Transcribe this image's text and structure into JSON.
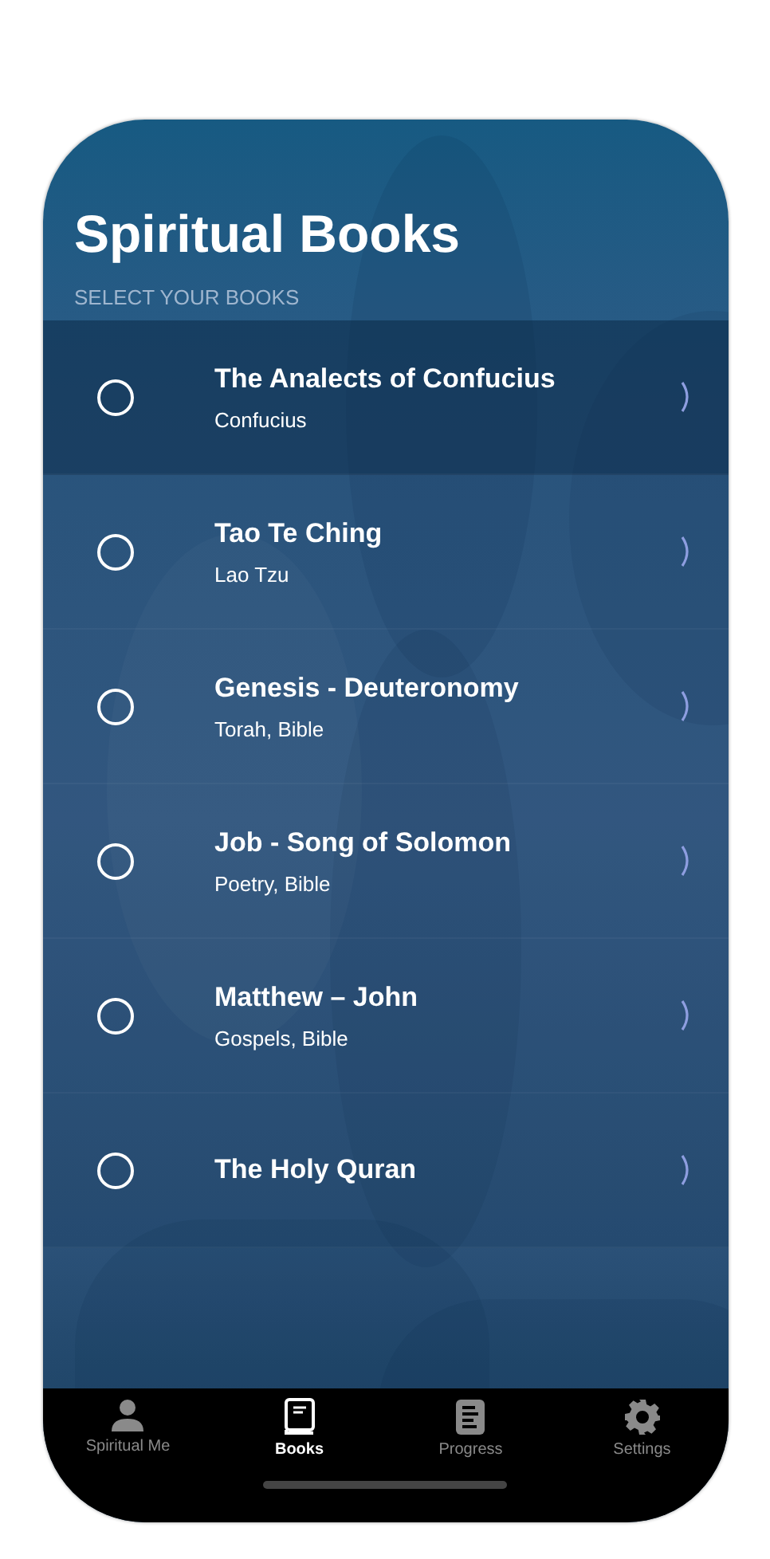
{
  "header": {
    "title": "Spiritual Books",
    "section_label": "SELECT YOUR BOOKS"
  },
  "books": [
    {
      "title": "The Analects of Confucius",
      "subtitle": "Confucius",
      "checked": false,
      "highlighted": true
    },
    {
      "title": "Tao Te Ching",
      "subtitle": "Lao Tzu",
      "checked": false,
      "highlighted": false
    },
    {
      "title": "Genesis - Deuteronomy",
      "subtitle": "Torah, Bible",
      "checked": false,
      "highlighted": false
    },
    {
      "title": "Job - Song of Solomon",
      "subtitle": "Poetry, Bible",
      "checked": false,
      "highlighted": false
    },
    {
      "title": "Matthew – John",
      "subtitle": "Gospels, Bible",
      "checked": false,
      "highlighted": false
    },
    {
      "title": "The Holy Quran",
      "checked": false,
      "highlighted": false
    }
  ],
  "tab_bar": [
    {
      "label": "Spiritual Me",
      "kind": "person",
      "selected": false
    },
    {
      "label": "Books",
      "kind": "book",
      "selected": true
    },
    {
      "label": "Progress",
      "kind": "progress",
      "selected": false
    },
    {
      "label": "Settings",
      "kind": "gear",
      "selected": false
    }
  ]
}
